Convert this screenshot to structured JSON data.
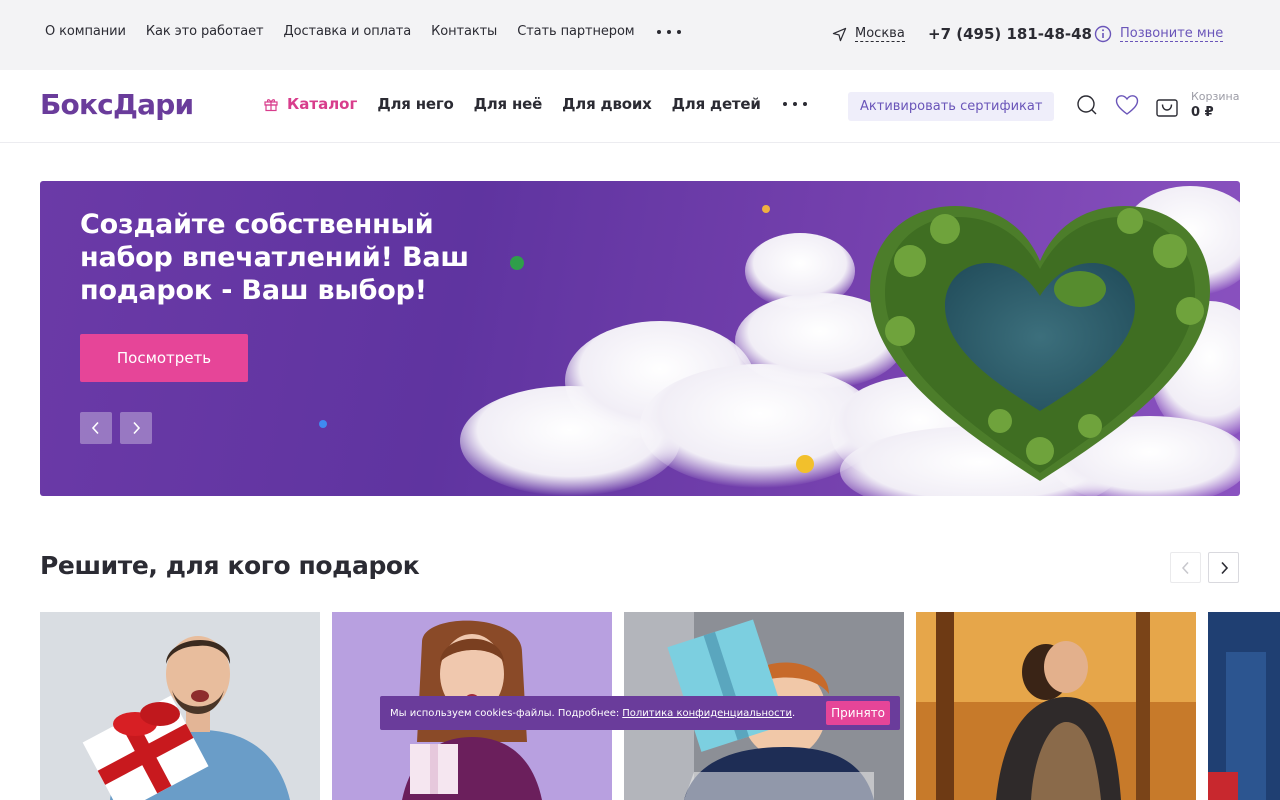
{
  "topbar": {
    "links": [
      "О компании",
      "Как это работает",
      "Доставка и оплата",
      "Контакты",
      "Стать партнером"
    ],
    "city": "Москва",
    "phone": "+7 (495) 181-48-48",
    "callback": "Позвоните мне"
  },
  "header": {
    "logo": "БоксДари",
    "catalog": "Каталог",
    "nav": [
      "Для него",
      "Для неё",
      "Для двоих",
      "Для детей"
    ],
    "certificate_button": "Активировать сертификат",
    "cart_label": "Корзина",
    "cart_sum": "0 ₽"
  },
  "hero": {
    "title": "Создайте собственный набор впечатлений! Ваш подарок - Ваш выбор!",
    "cta": "Посмотреть"
  },
  "section": {
    "title": "Решите, для кого подарок"
  },
  "cookie": {
    "text": "Мы используем cookies-файлы. Подробнее:",
    "link": "Политика конфиденциальности",
    "period": ".",
    "accept": "Принято"
  },
  "colors": {
    "accent_pink": "#e64598",
    "brand_purple": "#6a3c9b",
    "link_purple": "#6a55b9"
  },
  "icons": [
    "location-arrow-icon",
    "info-icon",
    "gift-icon",
    "search-icon",
    "heart-icon",
    "cart-bag-icon",
    "chevron-left-icon",
    "chevron-right-icon"
  ]
}
